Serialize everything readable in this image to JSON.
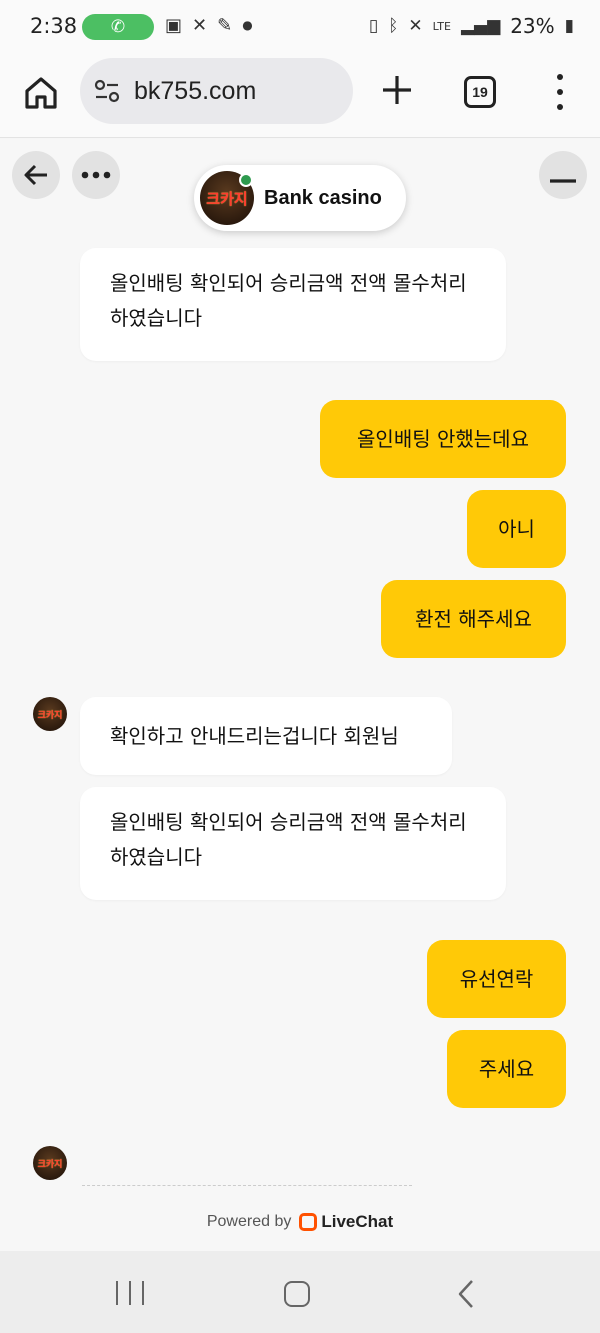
{
  "status_bar": {
    "time": "2:38",
    "battery": "23%",
    "network": "LTE"
  },
  "browser": {
    "url": "bk755.com",
    "tab_count": "19"
  },
  "chat": {
    "agent_name": "Bank casino",
    "agent_logo_text": "크카지",
    "messages": [
      {
        "from": "agent",
        "text": "올인배팅 확인되어 승리금액 전액 몰수처리 하였습니다"
      },
      {
        "from": "visitor",
        "text": "올인배팅 안했는데요"
      },
      {
        "from": "visitor",
        "text": "아니"
      },
      {
        "from": "visitor",
        "text": "환전 해주세요"
      },
      {
        "from": "agent",
        "text": "확인하고 안내드리는겁니다 회원님"
      },
      {
        "from": "agent",
        "text": "올인배팅 확인되어 승리금액 전액 몰수처리 하였습니다"
      },
      {
        "from": "visitor",
        "text": "유선연락"
      },
      {
        "from": "visitor",
        "text": "주세요"
      }
    ],
    "powered_by": "Powered by",
    "brand": "LiveChat"
  },
  "colors": {
    "visitor_bubble": "#ffc907",
    "agent_bubble": "#ffffff",
    "online": "#2e9a4e"
  }
}
